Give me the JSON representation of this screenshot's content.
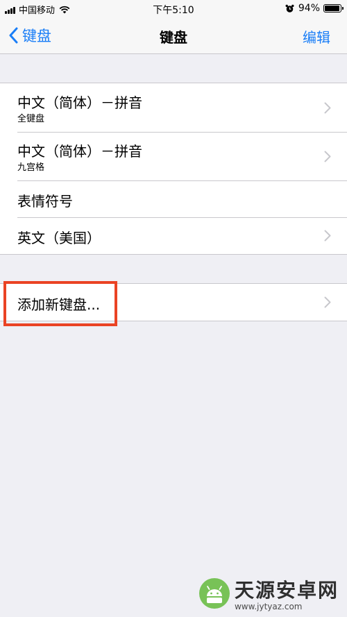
{
  "status_bar": {
    "carrier": "中国移动",
    "time": "下午5:10",
    "battery_percent": "94%",
    "battery_level": 0.94,
    "icons": [
      "signal-icon",
      "wifi-icon",
      "alarm-icon",
      "battery-icon"
    ]
  },
  "nav": {
    "back_label": "键盘",
    "title": "键盘",
    "edit_label": "编辑"
  },
  "keyboards": [
    {
      "title": "中文（简体）－拼音",
      "subtitle": "全键盘",
      "chevron": true
    },
    {
      "title": "中文（简体）－拼音",
      "subtitle": "九宫格",
      "chevron": true
    },
    {
      "title": "表情符号",
      "subtitle": "",
      "chevron": false
    },
    {
      "title": "英文（美国）",
      "subtitle": "",
      "chevron": true
    }
  ],
  "add_keyboard": {
    "label": "添加新键盘..."
  },
  "colors": {
    "accent": "#1a7ef7",
    "highlight": "#ea4324",
    "background": "#efeff4"
  },
  "watermark": {
    "name": "天源安卓网",
    "url": "www.jytyaz.com"
  }
}
